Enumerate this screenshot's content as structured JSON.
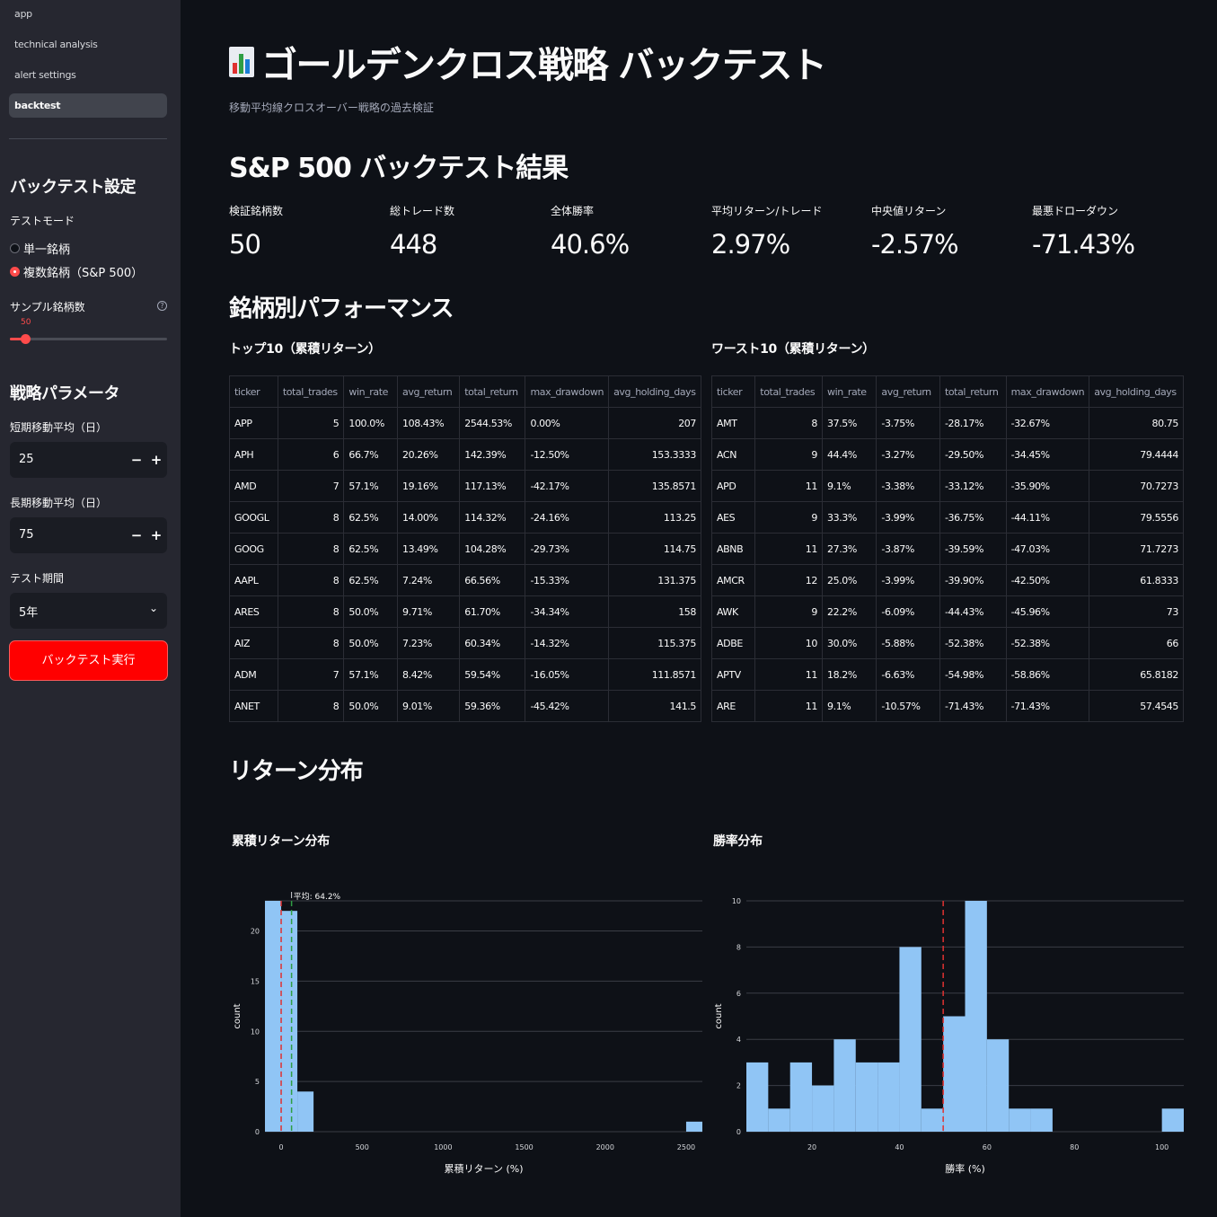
{
  "sidebar": {
    "nav": [
      "app",
      "technical analysis",
      "alert settings",
      "backtest"
    ],
    "settings_title": "バックテスト設定",
    "test_mode_label": "テストモード",
    "test_mode_options": [
      "単一銘柄",
      "複数銘柄（S&P 500）"
    ],
    "sample_count_label": "サンプル銘柄数",
    "sample_count_value": "50",
    "sample_count": 50,
    "help_icon": "?",
    "strategy_title": "戦略パラメータ",
    "short_ma_label": "短期移動平均（日）",
    "short_ma_value": "25",
    "long_ma_label": "長期移動平均（日）",
    "long_ma_value": "75",
    "period_label": "テスト期間",
    "period_value": "5年",
    "chevron": "⌄",
    "minus": "−",
    "plus": "+",
    "run_button": "バックテスト実行",
    "accent": "#ff4b4b"
  },
  "main": {
    "title": "ゴールデンクロス戦略 バックテスト",
    "subtitle": "移動平均線クロスオーバー戦略の過去検証",
    "results_title": "S&P 500 バックテスト結果",
    "metrics": [
      {
        "label": "検証銘柄数",
        "value": "50"
      },
      {
        "label": "総トレード数",
        "value": "448"
      },
      {
        "label": "全体勝率",
        "value": "40.6%"
      },
      {
        "label": "平均リターン/トレード",
        "value": "2.97%"
      },
      {
        "label": "中央値リターン",
        "value": "-2.57%"
      },
      {
        "label": "最悪ドローダウン",
        "value": "-71.43%"
      }
    ],
    "performance_title": "銘柄別パフォーマンス",
    "top_title": "トップ10（累積リターン）",
    "worst_title": "ワースト10（累積リターン）",
    "columns": [
      "ticker",
      "total_trades",
      "win_rate",
      "avg_return",
      "total_return",
      "max_drawdown",
      "avg_holding_days"
    ],
    "top_rows": [
      [
        "APP",
        "5",
        "100.0%",
        "108.43%",
        "2544.53%",
        "0.00%",
        "207"
      ],
      [
        "APH",
        "6",
        "66.7%",
        "20.26%",
        "142.39%",
        "-12.50%",
        "153.3333"
      ],
      [
        "AMD",
        "7",
        "57.1%",
        "19.16%",
        "117.13%",
        "-42.17%",
        "135.8571"
      ],
      [
        "GOOGL",
        "8",
        "62.5%",
        "14.00%",
        "114.32%",
        "-24.16%",
        "113.25"
      ],
      [
        "GOOG",
        "8",
        "62.5%",
        "13.49%",
        "104.28%",
        "-29.73%",
        "114.75"
      ],
      [
        "AAPL",
        "8",
        "62.5%",
        "7.24%",
        "66.56%",
        "-15.33%",
        "131.375"
      ],
      [
        "ARES",
        "8",
        "50.0%",
        "9.71%",
        "61.70%",
        "-34.34%",
        "158"
      ],
      [
        "AIZ",
        "8",
        "50.0%",
        "7.23%",
        "60.34%",
        "-14.32%",
        "115.375"
      ],
      [
        "ADM",
        "7",
        "57.1%",
        "8.42%",
        "59.54%",
        "-16.05%",
        "111.8571"
      ],
      [
        "ANET",
        "8",
        "50.0%",
        "9.01%",
        "59.36%",
        "-45.42%",
        "141.5"
      ]
    ],
    "worst_rows": [
      [
        "AMT",
        "8",
        "37.5%",
        "-3.75%",
        "-28.17%",
        "-32.67%",
        "80.75"
      ],
      [
        "ACN",
        "9",
        "44.4%",
        "-3.27%",
        "-29.50%",
        "-34.45%",
        "79.4444"
      ],
      [
        "APD",
        "11",
        "9.1%",
        "-3.38%",
        "-33.12%",
        "-35.90%",
        "70.7273"
      ],
      [
        "AES",
        "9",
        "33.3%",
        "-3.99%",
        "-36.75%",
        "-44.11%",
        "79.5556"
      ],
      [
        "ABNB",
        "11",
        "27.3%",
        "-3.87%",
        "-39.59%",
        "-47.03%",
        "71.7273"
      ],
      [
        "AMCR",
        "12",
        "25.0%",
        "-3.99%",
        "-39.90%",
        "-42.50%",
        "61.8333"
      ],
      [
        "AWK",
        "9",
        "22.2%",
        "-6.09%",
        "-44.43%",
        "-45.96%",
        "73"
      ],
      [
        "ADBE",
        "10",
        "30.0%",
        "-5.88%",
        "-52.38%",
        "-52.38%",
        "66"
      ],
      [
        "APTV",
        "11",
        "18.2%",
        "-6.63%",
        "-54.98%",
        "-58.86%",
        "65.8182"
      ],
      [
        "ARE",
        "11",
        "9.1%",
        "-10.57%",
        "-71.43%",
        "-71.43%",
        "57.4545"
      ]
    ],
    "distribution_title": "リターン分布"
  },
  "chart_data": [
    {
      "type": "bar",
      "title": "累積リターン分布",
      "xlabel": "累積リターン (%)",
      "ylabel": "count",
      "bin_edges": [
        -100,
        0,
        100,
        200
      ],
      "values": [
        23,
        22,
        4
      ],
      "extra_bins": [
        {
          "x0": 2500,
          "x1": 2600,
          "count": 1
        }
      ],
      "xlim": [
        -100,
        2600
      ],
      "ylim": [
        0,
        23
      ],
      "xticks": [
        0,
        500,
        1000,
        1500,
        2000,
        2500
      ],
      "yticks": [
        0,
        5,
        10,
        15,
        20
      ],
      "vlines": [
        {
          "x": 0,
          "color": "#e03131",
          "dash": true
        },
        {
          "x": 64.2,
          "color": "#2f9e44",
          "dash": true
        }
      ],
      "annotation": "平均: 64.2%",
      "bar_color": "#90c5f5",
      "grid": true
    },
    {
      "type": "bar",
      "title": "勝率分布",
      "xlabel": "勝率 (%)",
      "ylabel": "count",
      "bin_edges": [
        5,
        10,
        15,
        20,
        25,
        30,
        35,
        40,
        45,
        50,
        55,
        60,
        65,
        70,
        75,
        80,
        85,
        90,
        95,
        100,
        105
      ],
      "values": [
        3,
        1,
        3,
        2,
        4,
        3,
        3,
        8,
        1,
        5,
        10,
        4,
        1,
        1,
        0,
        0,
        0,
        0,
        0,
        1
      ],
      "xlim": [
        5,
        105
      ],
      "ylim": [
        0,
        10
      ],
      "xticks": [
        20,
        40,
        60,
        80,
        100
      ],
      "yticks": [
        0,
        2,
        4,
        6,
        8,
        10
      ],
      "vlines": [
        {
          "x": 50,
          "color": "#e03131",
          "dash": true
        }
      ],
      "bar_color": "#90c5f5",
      "grid": true
    }
  ]
}
